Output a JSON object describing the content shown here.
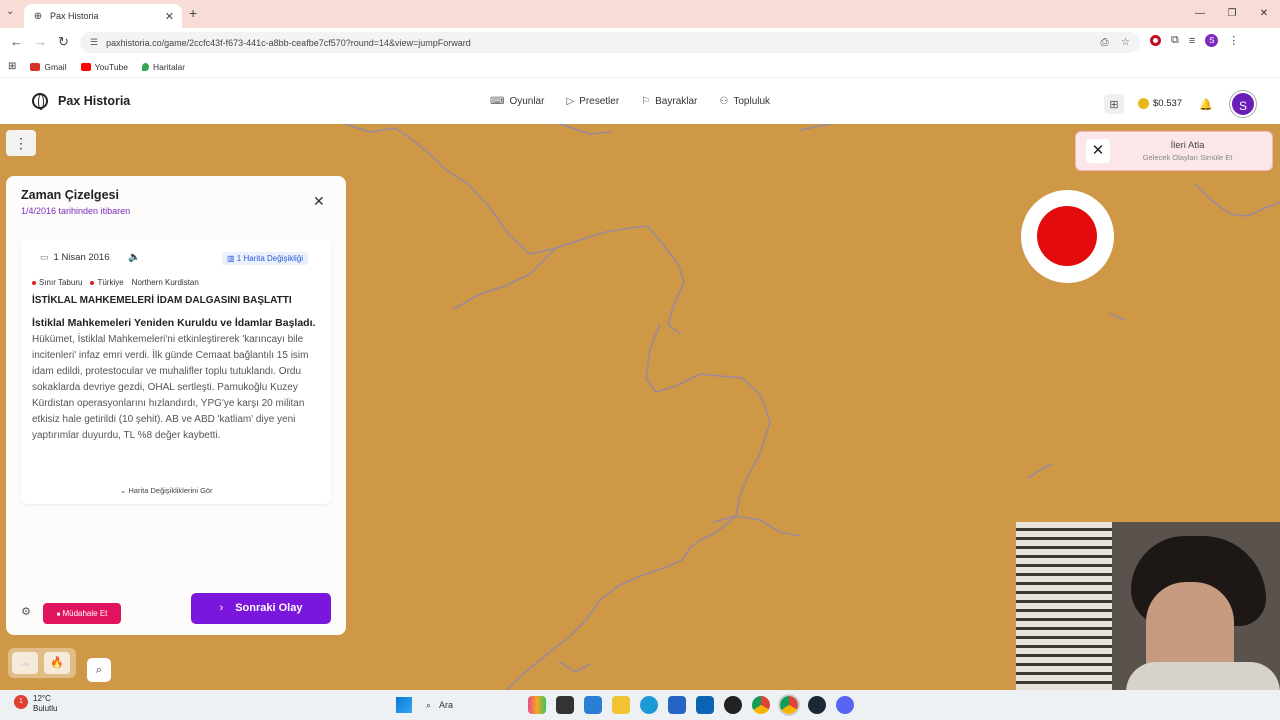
{
  "browser": {
    "tab_title": "Pax Historia",
    "url": "paxhistoria.co/game/2ccfc43f-f673-441c-a8bb-ceafbe7cf570?round=14&view=jumpForward",
    "bookmarks": [
      {
        "label": "Gmail",
        "color": "#d93025"
      },
      {
        "label": "YouTube",
        "color": "#ff0000"
      },
      {
        "label": "Haritalar",
        "color": "#34a853"
      }
    ],
    "profile_initial": "S"
  },
  "header": {
    "brand": "Pax Historia",
    "nav": [
      {
        "label": "Oyunlar",
        "icon": "gamepad-icon"
      },
      {
        "label": "Presetler",
        "icon": "play-icon"
      },
      {
        "label": "Bayraklar",
        "icon": "flag-icon"
      },
      {
        "label": "Topluluk",
        "icon": "users-icon"
      }
    ],
    "balance": "$0.537",
    "avatar_initial": "S"
  },
  "skip_toast": {
    "title": "İleri Atla",
    "subtitle": "Gelecek Olayları Simüle Et"
  },
  "timeline": {
    "title": "Zaman Çizelgesi",
    "subtitle": "1/4/2016 tarihinden itibaren",
    "event": {
      "date": "1 Nisan 2016",
      "map_changes": "1 Harita Değişikliği",
      "tags": [
        "Sınır Taburu",
        "Türkiye",
        "Northern Kurdistan"
      ],
      "headline": "İSTİKLAL MAHKEMELERİ İDAM DALGASINI BAŞLATTI",
      "lead": "İstiklal Mahkemeleri Yeniden Kuruldu ve İdamlar Başladı.",
      "body": "Hükümet, İstiklal Mahkemeleri'ni etkinleştirerek 'karıncayı bile incitenleri' infaz emri verdi. İlk günde Cemaat bağlantılı 15 isim idam edildi, protestocular ve muhalifler toplu tutuklandı. Ordu sokaklarda devriye gezdi, OHAL sertleşti. Pamukoğlu Kuzey Kürdistan operasyonlarını hızlandırdı, YPG'ye karşı 20 militan etkisiz hale getirildi (10 şehit). AB ve ABD 'katliam' diye yeni yaptırımlar duyurdu, TL %8 değer kaybetti.",
      "more": "Harita Değişikliklerini Gör"
    },
    "intervene": "Müdahale Et",
    "next_event": "Sonraki Olay"
  },
  "taskbar": {
    "temperature": "12°C",
    "condition": "Bulutlu",
    "search": "Ara"
  },
  "colors": {
    "map": "#cf9847",
    "river": "#9a8a9a",
    "accent": "#7b16dd",
    "intervene": "#e0135e",
    "record": "#e30b0b"
  }
}
